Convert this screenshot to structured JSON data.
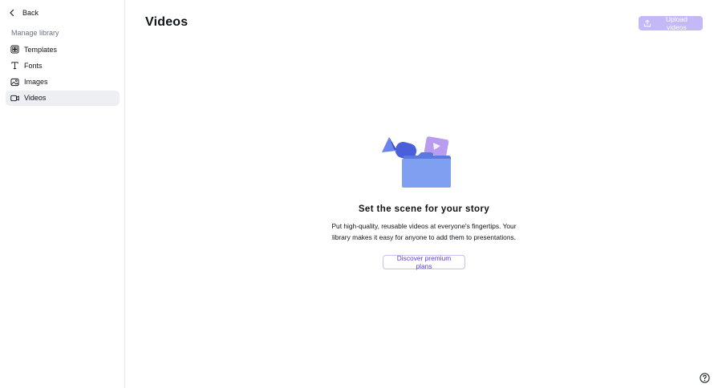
{
  "sidebar": {
    "back_label": "Back",
    "section_label": "Manage library",
    "items": [
      {
        "label": "Templates",
        "icon": "templates-icon",
        "active": false
      },
      {
        "label": "Fonts",
        "icon": "fonts-icon",
        "active": false
      },
      {
        "label": "Images",
        "icon": "image-icon",
        "active": false
      },
      {
        "label": "Videos",
        "icon": "video-icon",
        "active": true
      }
    ]
  },
  "header": {
    "title": "Videos",
    "upload_label": "Upload videos"
  },
  "empty_state": {
    "title": "Set the scene for your story",
    "description": "Put high-quality, reusable videos at everyone's fingertips. Your library makes it easy for anyone to add them to presentations.",
    "cta_label": "Discover premium plans"
  },
  "colors": {
    "accent": "#7d2ae8",
    "upload_button_bg": "#c5b8f6",
    "cta_text": "#5b3fd6",
    "active_item_bg": "#eeeff2"
  }
}
